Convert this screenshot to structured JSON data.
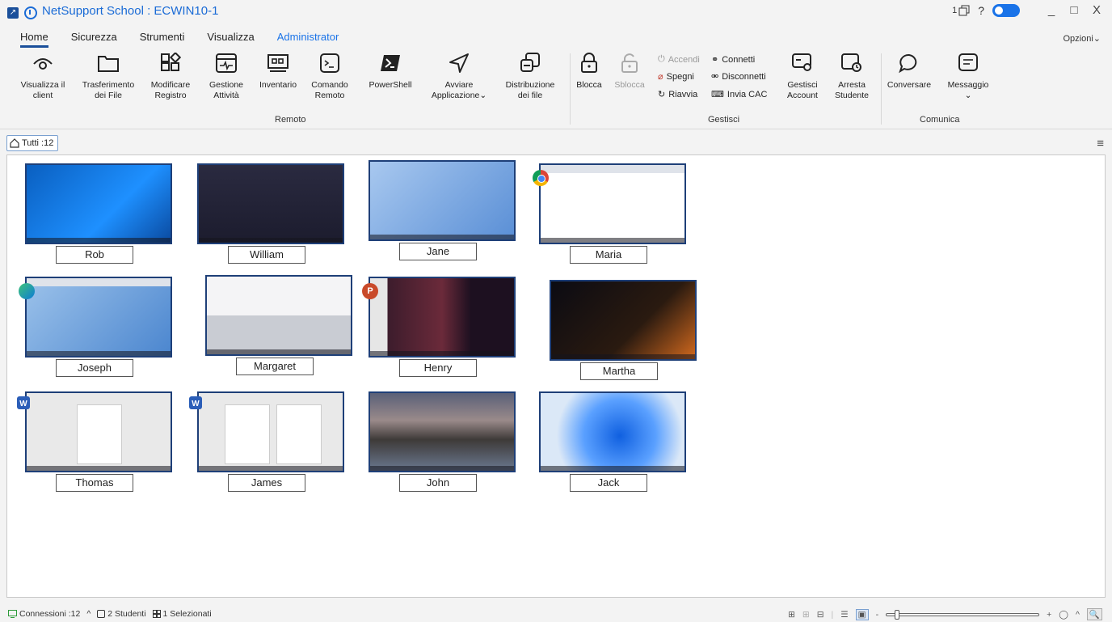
{
  "window": {
    "title": "NetSupport School : ECWIN10-1",
    "notification_count": "1",
    "help": "?",
    "minimize": "_",
    "maximize": "□",
    "close": "X"
  },
  "menu": {
    "tabs": [
      "Home",
      "Sicurezza",
      "Strumenti",
      "Visualizza",
      "Administrator"
    ],
    "options": "Opzioni⌄"
  },
  "ribbon": {
    "remote": {
      "label": "Remoto",
      "view_client": "Visualizza il client",
      "file_transfer": "Trasferimento dei File",
      "edit_registry": "Modificare Registro",
      "task_manager": "Gestione Attività",
      "inventory": "Inventario",
      "remote_command": "Comando Remoto",
      "powershell": "PowerShell",
      "launch_app": "Avviare Applicazione⌄",
      "file_distribution": "Distribuzione dei file"
    },
    "manage": {
      "label": "Gestisci",
      "lock": "Blocca",
      "unlock": "Sblocca",
      "power_on": "Accendi",
      "power_off": "Spegni",
      "restart": "Riavvia",
      "connect": "Connetti",
      "disconnect": "Disconnetti",
      "send_cad": "Invia CAC",
      "manage_account": "Gestisci Account",
      "stop_student": "Arresta Studente"
    },
    "communicate": {
      "label": "Comunica",
      "chat": "Conversare",
      "message": "Messaggio",
      "message_dropdown": "⌄"
    }
  },
  "groups": {
    "all_tab": "Tutti :12"
  },
  "students": [
    {
      "name": "Rob",
      "screen": "win10"
    },
    {
      "name": "William",
      "screen": "chromeos"
    },
    {
      "name": "Jane",
      "screen": "win11-explorer"
    },
    {
      "name": "Maria",
      "screen": "chrome-browser",
      "badge": "chrome"
    },
    {
      "name": "Joseph",
      "screen": "edge-browser",
      "badge": "edge"
    },
    {
      "name": "Margaret",
      "screen": "ipad-keyboard"
    },
    {
      "name": "Henry",
      "screen": "powerpoint",
      "badge": "ppt"
    },
    {
      "name": "Martha",
      "screen": "android"
    },
    {
      "name": "Thomas",
      "screen": "word",
      "badge": "word"
    },
    {
      "name": "James",
      "screen": "word2",
      "badge": "word"
    },
    {
      "name": "John",
      "screen": "macos"
    },
    {
      "name": "Jack",
      "screen": "win11"
    }
  ],
  "status": {
    "connections": "Connessioni :12",
    "caret": "^",
    "students": "2 Studenti",
    "selected": "1 Selezionati",
    "zoom_minus": "-",
    "zoom_plus": "+"
  },
  "colors": {
    "accent": "#1a4f9a",
    "title_blue": "#1a6bd6",
    "thumb_border": "#1e3f78"
  }
}
